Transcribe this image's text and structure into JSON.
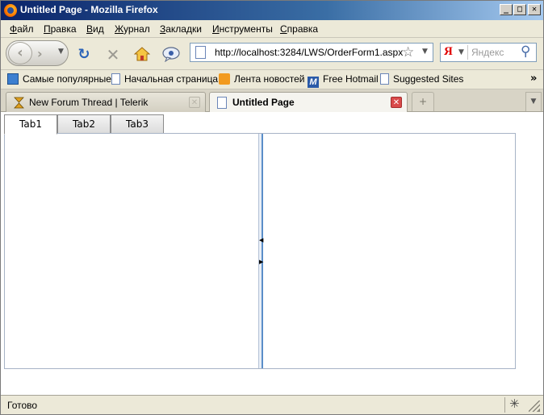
{
  "window": {
    "title": "Untitled Page - Mozilla Firefox"
  },
  "window_controls": {
    "minimize": "_",
    "maximize": "□",
    "close": "✕"
  },
  "menubar": {
    "items": [
      {
        "label": "Файл"
      },
      {
        "label": "Правка"
      },
      {
        "label": "Вид"
      },
      {
        "label": "Журнал"
      },
      {
        "label": "Закладки"
      },
      {
        "label": "Инструменты"
      },
      {
        "label": "Справка"
      }
    ]
  },
  "navbar": {
    "back_glyph": "‹",
    "forward_glyph": "›",
    "dropdown_glyph": "▼",
    "reload_glyph": "↻",
    "stop_glyph": "✕",
    "home_glyph": "⌂",
    "feedback_glyph": "💬",
    "url": "http://localhost:3284/LWS/OrderForm1.aspx",
    "bookmark_star": "☆",
    "search_engine_glyph": "Я",
    "search_placeholder": "Яндекс",
    "search_go_glyph": "⚲"
  },
  "bookmarks": {
    "items": [
      {
        "label": "Самые популярные",
        "icon": "most-visited-icon"
      },
      {
        "label": "Начальная страница",
        "icon": "page-icon"
      },
      {
        "label": "Лента новостей",
        "icon": "rss-icon"
      },
      {
        "label": "Free Hotmail",
        "icon": "hotmail-icon",
        "glyph": "M"
      },
      {
        "label": "Suggested Sites",
        "icon": "page-icon"
      }
    ],
    "more": "»"
  },
  "browser_tabs": [
    {
      "label": "New Forum Thread | Telerik",
      "active": false
    },
    {
      "label": "Untitled Page",
      "active": true
    }
  ],
  "browser_tab_close": "✕",
  "new_tab_glyph": "+",
  "all_tabs_glyph": "▼",
  "page": {
    "tabs": [
      {
        "label": "Tab1",
        "active": true
      },
      {
        "label": "Tab2",
        "active": false
      },
      {
        "label": "Tab3",
        "active": false
      }
    ],
    "splitter": {
      "collapse_left": "◀",
      "collapse_right": "▶"
    }
  },
  "statusbar": {
    "text": "Готово",
    "extension_glyph": "✳"
  },
  "colors": {
    "titlebar": "#0a246a",
    "splitter": "#5a8ec9",
    "close_tab": "#d94a4a"
  }
}
